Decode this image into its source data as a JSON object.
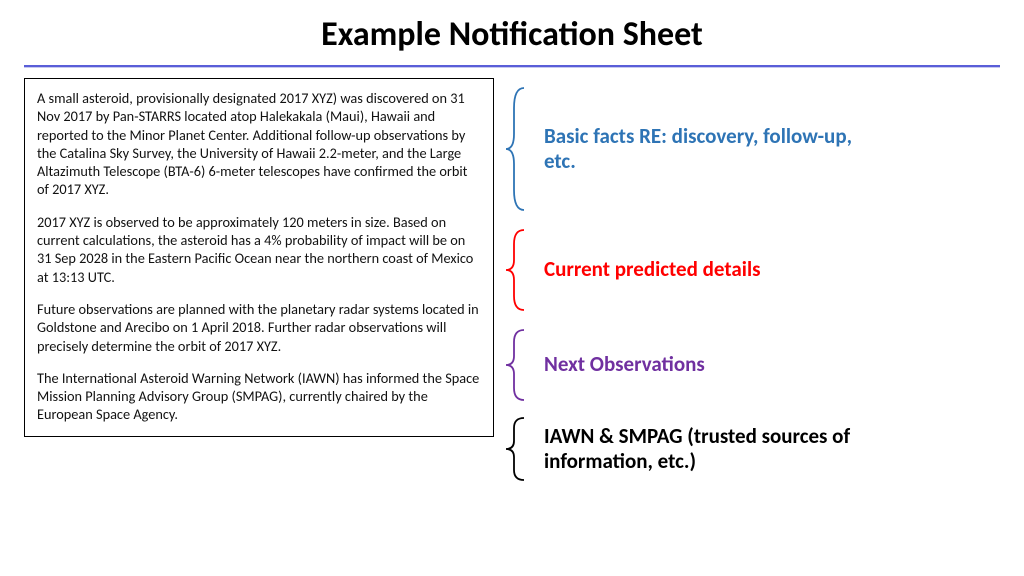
{
  "title": "Example Notification Sheet",
  "sheet": {
    "p1": "A small asteroid, provisionally designated 2017 XYZ) was discovered on 31 Nov 2017 by Pan-STARRS located atop Halekakala (Maui), Hawaii and reported to the Minor Planet Center.  Additional follow-up observations by the Catalina Sky Survey, the University of Hawaii 2.2-meter, and the Large Altazimuth Telescope (BTA-6) 6-meter telescopes have confirmed the orbit of 2017 XYZ.",
    "p2": "2017 XYZ is observed to be approximately 120 meters in size.  Based on current calculations, the asteroid has a 4% probability of impact will be on 31 Sep 2028 in the Eastern Pacific Ocean near the northern coast of Mexico at 13:13 UTC.",
    "p3": "Future observations are planned with the planetary radar systems located in Goldstone and Arecibo on 1 April 2018.  Further radar observations will precisely determine the orbit of 2017 XYZ.",
    "p4": "The International Asteroid Warning Network (IAWN) has informed the Space Mission Planning Advisory Group (SMPAG), currently chaired by the European Space Agency."
  },
  "annotations": {
    "a1": "Basic facts RE: discovery, follow-up, etc.",
    "a2": "Current predicted details",
    "a3": "Next Observations",
    "a4": "IAWN & SMPAG (trusted sources of information, etc.)"
  },
  "colors": {
    "blue": "#2e74b5",
    "red": "#ff0000",
    "purple": "#7030a0",
    "black": "#000000"
  }
}
